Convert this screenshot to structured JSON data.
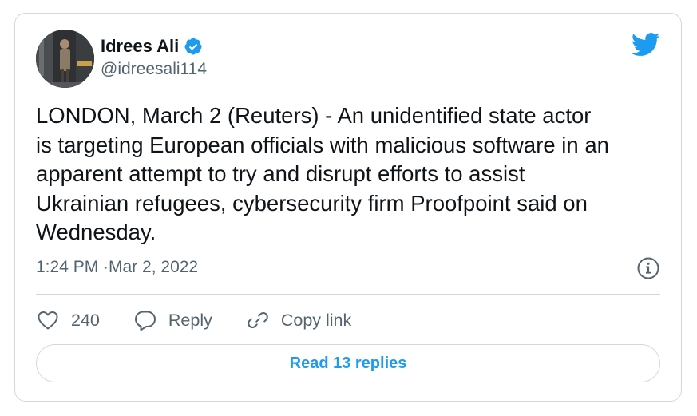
{
  "tweet": {
    "author": {
      "display_name": "Idrees Ali",
      "handle": "@idreesali114",
      "verified": true
    },
    "text": "LONDON, March 2 (Reuters) - An unidentified state actor\nis targeting European officials with malicious software in an\napparent attempt to try and disrupt efforts to assist\nUkrainian refugees, cybersecurity firm Proofpoint said on\nWednesday.",
    "time": "1:24 PM",
    "date": "Mar 2, 2022"
  },
  "actions": {
    "like_count": "240",
    "reply_label": "Reply",
    "copy_link_label": "Copy link"
  },
  "read_replies_label": "Read 13 replies",
  "icons": {
    "logo": "twitter-bird-icon",
    "verified": "verified-badge-icon",
    "info": "info-icon",
    "like": "heart-icon",
    "reply": "speech-bubble-icon",
    "copy_link": "link-icon"
  },
  "colors": {
    "brand_blue": "#1d9bf0",
    "text_primary": "#0f1419",
    "text_secondary": "#536471",
    "border": "#cfd9de"
  }
}
